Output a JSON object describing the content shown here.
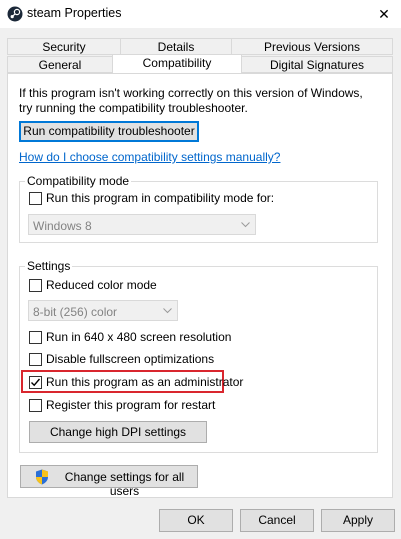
{
  "window": {
    "title": "steam Properties",
    "close_glyph": "✕"
  },
  "tabs": {
    "row1": [
      "Security",
      "Details",
      "Previous Versions"
    ],
    "row2": [
      "General",
      "Compatibility",
      "Digital Signatures"
    ],
    "active": "Compatibility"
  },
  "intro": {
    "line1": "If this program isn't working correctly on this version of Windows,",
    "line2": "try running the compatibility troubleshooter.",
    "troubleshooter_button": "Run compatibility troubleshooter",
    "manual_link": "How do I choose compatibility settings manually?"
  },
  "compat_mode": {
    "title": "Compatibility mode",
    "checkbox_label": "Run this program in compatibility mode for:",
    "checked": false,
    "os_select_value": "Windows 8"
  },
  "settings": {
    "title": "Settings",
    "reduced_color_label": "Reduced color mode",
    "reduced_color_checked": false,
    "color_select_value": "8-bit (256) color",
    "run_640_label": "Run in 640 x 480 screen resolution",
    "run_640_checked": false,
    "disable_fullscreen_label": "Disable fullscreen optimizations",
    "disable_fullscreen_checked": false,
    "run_admin_label": "Run this program as an administrator",
    "run_admin_checked": true,
    "register_restart_label": "Register this program for restart",
    "register_restart_checked": false,
    "dpi_button": "Change high DPI settings"
  },
  "all_users_button": "Change settings for all users",
  "footer": {
    "ok": "OK",
    "cancel": "Cancel",
    "apply": "Apply"
  },
  "colors": {
    "accent": "#0078d7",
    "highlight": "#d9262e",
    "link": "#0066cc"
  }
}
